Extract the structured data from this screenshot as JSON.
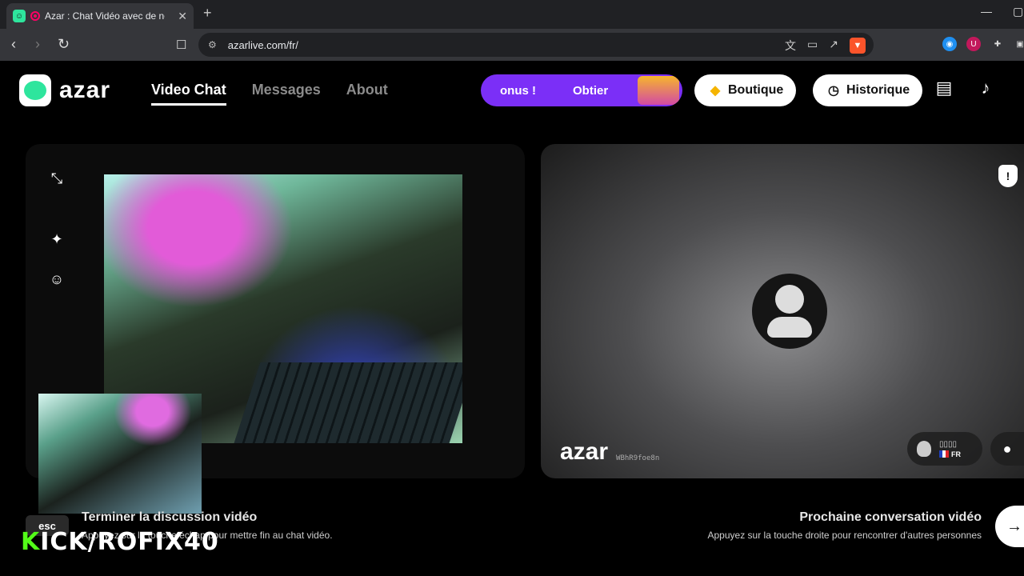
{
  "browser": {
    "tab_title": "Azar : Chat Vidéo avec de nou",
    "tab_close": "✕",
    "new_tab": "+",
    "url": "azarlive.com/fr/",
    "window_controls": [
      "—",
      "▢"
    ]
  },
  "header": {
    "logo_text": "azar",
    "nav": [
      {
        "label": "Video Chat",
        "active": true
      },
      {
        "label": "Messages",
        "active": false
      },
      {
        "label": "About",
        "active": false
      }
    ],
    "promo": {
      "left_text": "onus !",
      "right_text": "Obtier"
    },
    "shop_label": "Boutique",
    "history_label": "Historique"
  },
  "remote": {
    "watermark_logo": "azar",
    "watermark_id": "WBhR9foe8n",
    "peer_name": "▯▯▯▯",
    "peer_country": "FR"
  },
  "hints": {
    "end_key": "esc",
    "end_title": "Terminer la discussion vidéo",
    "end_sub": "Appuyez sur la touche échap pour mettre fin au chat vidéo.",
    "next_title": "Prochaine conversation vidéo",
    "next_sub": "Appuyez sur la touche droite pour rencontrer d'autres personnes",
    "next_key": "→"
  },
  "overlay": {
    "brand_k": "K",
    "brand_rest": "ICK/ROFIX40"
  },
  "colors": {
    "accent_green": "#2ee59d",
    "promo_purple": "#7b2ff7",
    "kick_green": "#53fc18"
  },
  "icons": [
    "back-icon",
    "forward-icon",
    "reload-icon",
    "bookmark-icon",
    "site-settings-icon",
    "translate-icon",
    "cast-icon",
    "share-icon",
    "brave-shield-icon",
    "extensions-icon",
    "fullscreen-exit-icon",
    "magic-wand-icon",
    "emoji-icon",
    "diamond-icon",
    "clock-icon",
    "inbox-icon",
    "bell-icon",
    "report-icon",
    "chat-bubble-icon"
  ]
}
